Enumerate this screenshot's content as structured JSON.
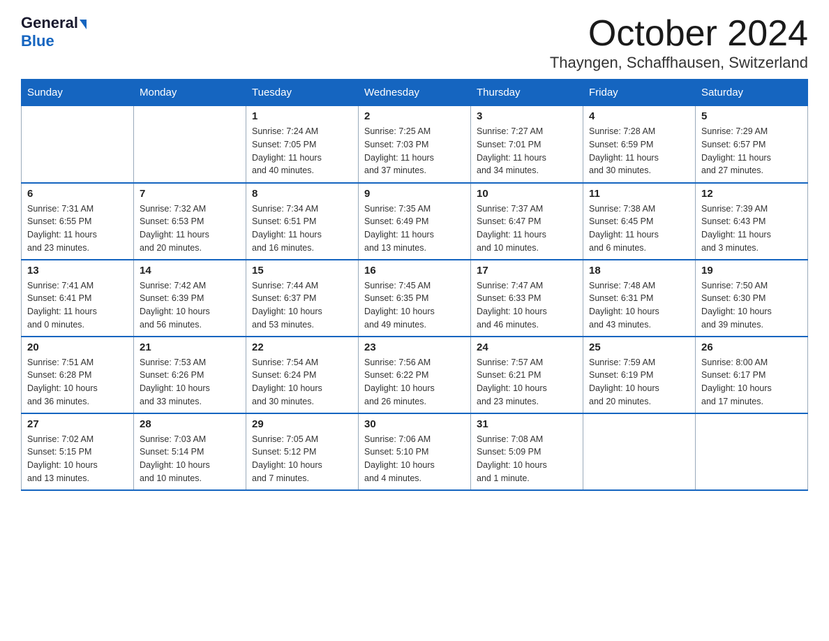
{
  "logo": {
    "general": "General",
    "blue": "Blue",
    "triangle_color": "#1565c0"
  },
  "header": {
    "month": "October 2024",
    "location": "Thayngen, Schaffhausen, Switzerland"
  },
  "days_of_week": [
    "Sunday",
    "Monday",
    "Tuesday",
    "Wednesday",
    "Thursday",
    "Friday",
    "Saturday"
  ],
  "weeks": [
    [
      {
        "day": "",
        "info": ""
      },
      {
        "day": "",
        "info": ""
      },
      {
        "day": "1",
        "info": "Sunrise: 7:24 AM\nSunset: 7:05 PM\nDaylight: 11 hours\nand 40 minutes."
      },
      {
        "day": "2",
        "info": "Sunrise: 7:25 AM\nSunset: 7:03 PM\nDaylight: 11 hours\nand 37 minutes."
      },
      {
        "day": "3",
        "info": "Sunrise: 7:27 AM\nSunset: 7:01 PM\nDaylight: 11 hours\nand 34 minutes."
      },
      {
        "day": "4",
        "info": "Sunrise: 7:28 AM\nSunset: 6:59 PM\nDaylight: 11 hours\nand 30 minutes."
      },
      {
        "day": "5",
        "info": "Sunrise: 7:29 AM\nSunset: 6:57 PM\nDaylight: 11 hours\nand 27 minutes."
      }
    ],
    [
      {
        "day": "6",
        "info": "Sunrise: 7:31 AM\nSunset: 6:55 PM\nDaylight: 11 hours\nand 23 minutes."
      },
      {
        "day": "7",
        "info": "Sunrise: 7:32 AM\nSunset: 6:53 PM\nDaylight: 11 hours\nand 20 minutes."
      },
      {
        "day": "8",
        "info": "Sunrise: 7:34 AM\nSunset: 6:51 PM\nDaylight: 11 hours\nand 16 minutes."
      },
      {
        "day": "9",
        "info": "Sunrise: 7:35 AM\nSunset: 6:49 PM\nDaylight: 11 hours\nand 13 minutes."
      },
      {
        "day": "10",
        "info": "Sunrise: 7:37 AM\nSunset: 6:47 PM\nDaylight: 11 hours\nand 10 minutes."
      },
      {
        "day": "11",
        "info": "Sunrise: 7:38 AM\nSunset: 6:45 PM\nDaylight: 11 hours\nand 6 minutes."
      },
      {
        "day": "12",
        "info": "Sunrise: 7:39 AM\nSunset: 6:43 PM\nDaylight: 11 hours\nand 3 minutes."
      }
    ],
    [
      {
        "day": "13",
        "info": "Sunrise: 7:41 AM\nSunset: 6:41 PM\nDaylight: 11 hours\nand 0 minutes."
      },
      {
        "day": "14",
        "info": "Sunrise: 7:42 AM\nSunset: 6:39 PM\nDaylight: 10 hours\nand 56 minutes."
      },
      {
        "day": "15",
        "info": "Sunrise: 7:44 AM\nSunset: 6:37 PM\nDaylight: 10 hours\nand 53 minutes."
      },
      {
        "day": "16",
        "info": "Sunrise: 7:45 AM\nSunset: 6:35 PM\nDaylight: 10 hours\nand 49 minutes."
      },
      {
        "day": "17",
        "info": "Sunrise: 7:47 AM\nSunset: 6:33 PM\nDaylight: 10 hours\nand 46 minutes."
      },
      {
        "day": "18",
        "info": "Sunrise: 7:48 AM\nSunset: 6:31 PM\nDaylight: 10 hours\nand 43 minutes."
      },
      {
        "day": "19",
        "info": "Sunrise: 7:50 AM\nSunset: 6:30 PM\nDaylight: 10 hours\nand 39 minutes."
      }
    ],
    [
      {
        "day": "20",
        "info": "Sunrise: 7:51 AM\nSunset: 6:28 PM\nDaylight: 10 hours\nand 36 minutes."
      },
      {
        "day": "21",
        "info": "Sunrise: 7:53 AM\nSunset: 6:26 PM\nDaylight: 10 hours\nand 33 minutes."
      },
      {
        "day": "22",
        "info": "Sunrise: 7:54 AM\nSunset: 6:24 PM\nDaylight: 10 hours\nand 30 minutes."
      },
      {
        "day": "23",
        "info": "Sunrise: 7:56 AM\nSunset: 6:22 PM\nDaylight: 10 hours\nand 26 minutes."
      },
      {
        "day": "24",
        "info": "Sunrise: 7:57 AM\nSunset: 6:21 PM\nDaylight: 10 hours\nand 23 minutes."
      },
      {
        "day": "25",
        "info": "Sunrise: 7:59 AM\nSunset: 6:19 PM\nDaylight: 10 hours\nand 20 minutes."
      },
      {
        "day": "26",
        "info": "Sunrise: 8:00 AM\nSunset: 6:17 PM\nDaylight: 10 hours\nand 17 minutes."
      }
    ],
    [
      {
        "day": "27",
        "info": "Sunrise: 7:02 AM\nSunset: 5:15 PM\nDaylight: 10 hours\nand 13 minutes."
      },
      {
        "day": "28",
        "info": "Sunrise: 7:03 AM\nSunset: 5:14 PM\nDaylight: 10 hours\nand 10 minutes."
      },
      {
        "day": "29",
        "info": "Sunrise: 7:05 AM\nSunset: 5:12 PM\nDaylight: 10 hours\nand 7 minutes."
      },
      {
        "day": "30",
        "info": "Sunrise: 7:06 AM\nSunset: 5:10 PM\nDaylight: 10 hours\nand 4 minutes."
      },
      {
        "day": "31",
        "info": "Sunrise: 7:08 AM\nSunset: 5:09 PM\nDaylight: 10 hours\nand 1 minute."
      },
      {
        "day": "",
        "info": ""
      },
      {
        "day": "",
        "info": ""
      }
    ]
  ]
}
